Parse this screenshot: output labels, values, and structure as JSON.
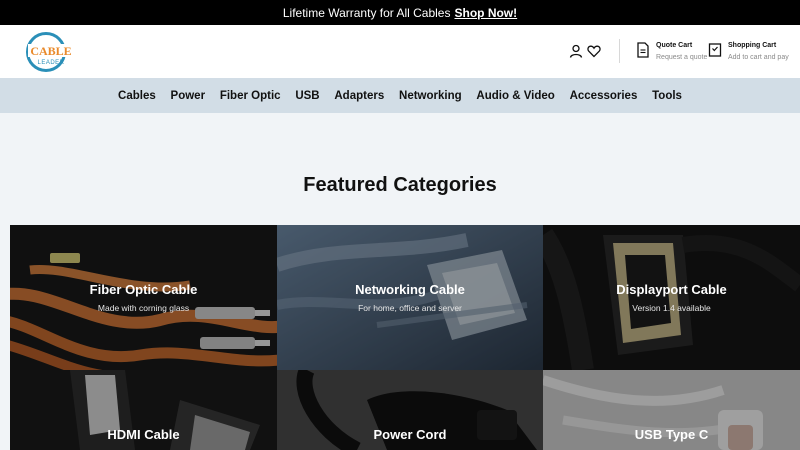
{
  "announcement": {
    "text": "Lifetime Warranty for All Cables",
    "link": "Shop Now!"
  },
  "brand": {
    "line1": "CABLE",
    "line2": "LEADER"
  },
  "header": {
    "quote_cart": {
      "title": "Quote Cart",
      "subtitle": "Request a quote"
    },
    "shopping_cart": {
      "title": "Shopping Cart",
      "subtitle": "Add to cart and pay"
    }
  },
  "nav": [
    "Cables",
    "Power",
    "Fiber Optic",
    "USB",
    "Adapters",
    "Networking",
    "Audio & Video",
    "Accessories",
    "Tools"
  ],
  "featured": {
    "title": "Featured Categories",
    "tiles": [
      {
        "title": "Fiber Optic Cable",
        "subtitle": "Made with corning glass"
      },
      {
        "title": "Networking Cable",
        "subtitle": "For home, office and server"
      },
      {
        "title": "Displayport Cable",
        "subtitle": "Version 1.4 available"
      },
      {
        "title": "HDMI Cable",
        "subtitle": ""
      },
      {
        "title": "Power Cord",
        "subtitle": ""
      },
      {
        "title": "USB Type C",
        "subtitle": ""
      }
    ]
  },
  "colors": {
    "nav_bg": "#d2dde6",
    "page_bg": "#f1f4f7",
    "brand_orange": "#e98a2b",
    "brand_blue": "#2a8fb8"
  }
}
